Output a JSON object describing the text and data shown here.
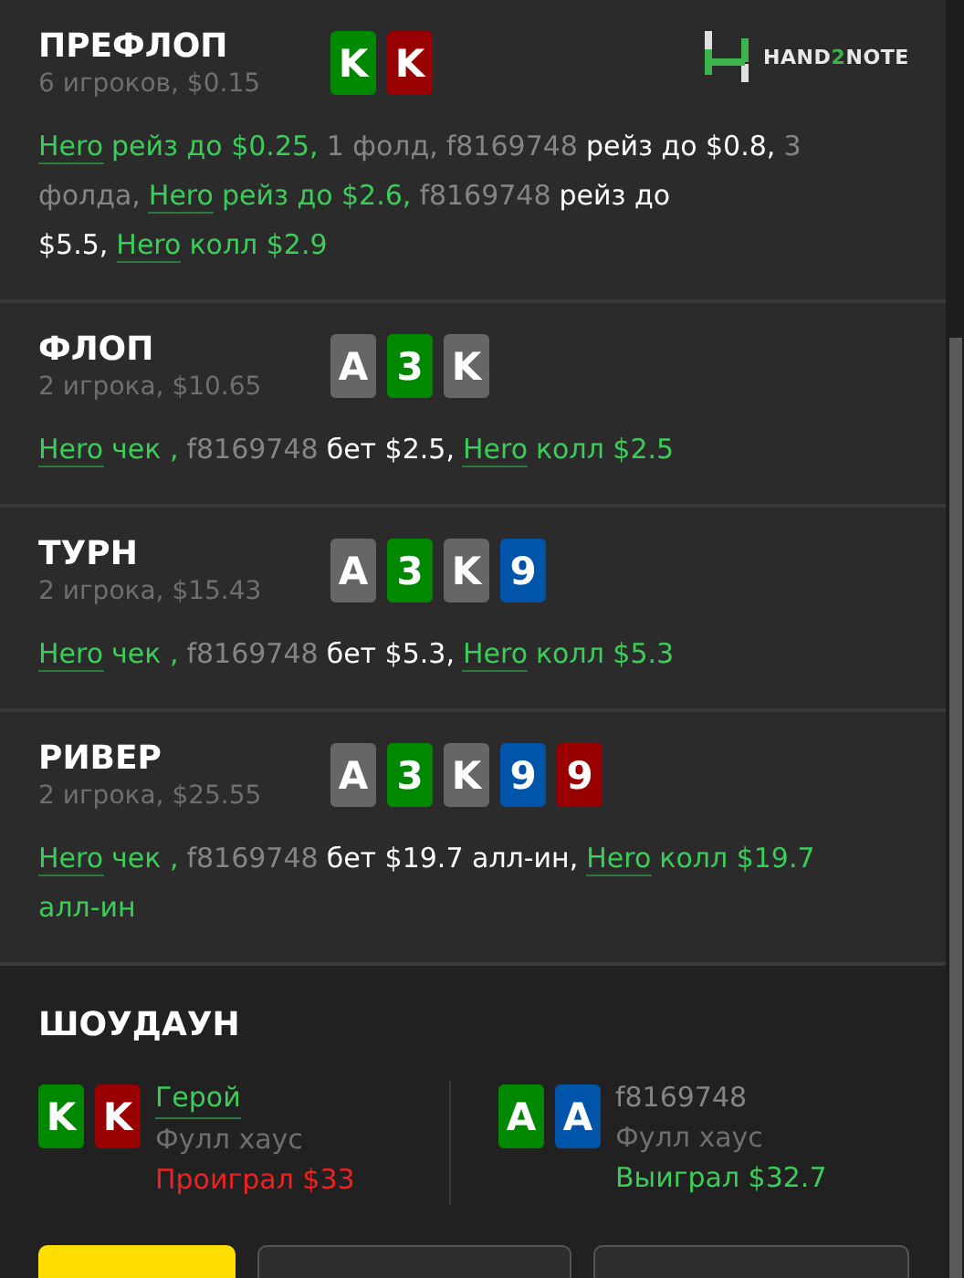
{
  "logo": {
    "parts": [
      "HAND",
      "2",
      "NOTE"
    ]
  },
  "streets": [
    {
      "name": "ПРЕФЛОП",
      "info": "6 игроков, $0.15",
      "cards": [
        {
          "rank": "K",
          "color": "#008800"
        },
        {
          "rank": "K",
          "color": "#990000"
        }
      ],
      "actions": [
        {
          "kind": "hero",
          "actor": "Hero",
          "text": "рейз до $0.25,"
        },
        {
          "kind": "fold",
          "text": "1 фолд,"
        },
        {
          "kind": "player",
          "actor": "f8169748",
          "text": "рейз до $0.8,"
        },
        {
          "kind": "fold",
          "text": "3 фолда,"
        },
        {
          "kind": "hero",
          "actor": "Hero",
          "text": "рейз до $2.6,"
        },
        {
          "kind": "player",
          "actor": "f8169748",
          "text": "рейз до $5.5,"
        },
        {
          "kind": "hero",
          "actor": "Hero",
          "text": "колл $2.9"
        }
      ]
    },
    {
      "name": "ФЛОП",
      "info": "2 игрока, $10.65",
      "cards": [
        {
          "rank": "A",
          "color": "#666666"
        },
        {
          "rank": "3",
          "color": "#008800"
        },
        {
          "rank": "K",
          "color": "#666666"
        }
      ],
      "actions": [
        {
          "kind": "hero",
          "actor": "Hero",
          "text": "чек ,"
        },
        {
          "kind": "player",
          "actor": "f8169748",
          "text": "бет $2.5,"
        },
        {
          "kind": "hero",
          "actor": "Hero",
          "text": "колл $2.5"
        }
      ]
    },
    {
      "name": "ТУРН",
      "info": "2 игрока, $15.43",
      "cards": [
        {
          "rank": "A",
          "color": "#666666"
        },
        {
          "rank": "3",
          "color": "#008800"
        },
        {
          "rank": "K",
          "color": "#666666"
        },
        {
          "rank": "9",
          "color": "#0055aa"
        }
      ],
      "actions": [
        {
          "kind": "hero",
          "actor": "Hero",
          "text": "чек ,"
        },
        {
          "kind": "player",
          "actor": "f8169748",
          "text": "бет $5.3,"
        },
        {
          "kind": "hero",
          "actor": "Hero",
          "text": "колл $5.3"
        }
      ]
    },
    {
      "name": "РИВЕР",
      "info": "2 игрока, $25.55",
      "cards": [
        {
          "rank": "A",
          "color": "#666666"
        },
        {
          "rank": "3",
          "color": "#008800"
        },
        {
          "rank": "K",
          "color": "#666666"
        },
        {
          "rank": "9",
          "color": "#0055aa"
        },
        {
          "rank": "9",
          "color": "#990000"
        }
      ],
      "actions": [
        {
          "kind": "hero",
          "actor": "Hero",
          "text": "чек ,"
        },
        {
          "kind": "player",
          "actor": "f8169748",
          "text": "бет $19.7 алл-ин,"
        },
        {
          "kind": "hero",
          "actor": "Hero",
          "text": "колл $19.7 алл-ин"
        }
      ]
    }
  ],
  "showdown": {
    "title": "ШОУДАУН",
    "players": [
      {
        "kind": "hero",
        "name": "Герой",
        "hand": "Фулл хаус",
        "won": false,
        "result": "Проиграл $33",
        "cards": [
          {
            "rank": "K",
            "color": "#008800"
          },
          {
            "rank": "K",
            "color": "#990000"
          }
        ]
      },
      {
        "kind": "player",
        "name": "f8169748",
        "hand": "Фулл хаус",
        "won": true,
        "result": "Выиграл $32.7",
        "cards": [
          {
            "rank": "A",
            "color": "#008800"
          },
          {
            "rank": "A",
            "color": "#0055aa"
          }
        ]
      }
    ]
  }
}
